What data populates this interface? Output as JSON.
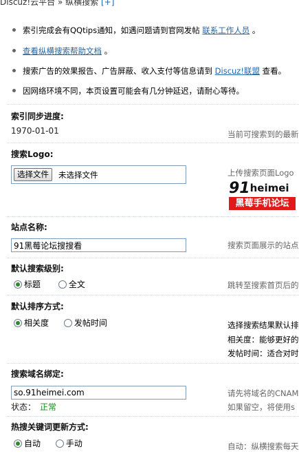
{
  "breadcrumb": {
    "text": "Discuz!云平台 » 纵横搜索",
    "plus": "[+]"
  },
  "tips": [
    {
      "text": "索引完成会有QQtips通知，如遇问题请到官网发帖 ",
      "link": "联系工作人员",
      "suffix": " 。"
    },
    {
      "text": "",
      "link": "查看纵横搜索帮助文档",
      "suffix": " 。"
    },
    {
      "text": "搜索广告的效果报告、广告屏蔽、收入支付等信息请到 ",
      "link": "Discuz!联盟",
      "suffix": " 查看。"
    },
    {
      "text": "因网络环境不同，本页设置可能会有几分钟延迟，请耐心等待。",
      "link": "",
      "suffix": ""
    }
  ],
  "sync": {
    "label": "索引同步进度:",
    "value": "1970-01-01",
    "hint": "当前可搜索到的最新"
  },
  "logo": {
    "label": "搜索Logo:",
    "button": "选择文件",
    "file_status": "未选择文件",
    "hint": "上传搜索页面Logo",
    "image_top_num": "91",
    "image_top_word": "heimei",
    "image_bottom": "黑莓手机论坛"
  },
  "site_name": {
    "label": "站点名称:",
    "value": "91黑莓论坛搜搜看",
    "hint": "搜索页面展示的站点"
  },
  "search_level": {
    "label": "默认搜索级别:",
    "options": [
      "标题",
      "全文"
    ],
    "selected": 0,
    "hint": "跳转至搜索首页后的"
  },
  "sort_order": {
    "label": "默认排序方式:",
    "options": [
      "相关度",
      "发帖时间"
    ],
    "selected": 0,
    "hints": [
      "选择搜索结果默认排",
      "相关度：能够更好的",
      "发帖时间：适合对时"
    ]
  },
  "domain": {
    "label": "搜索域名绑定:",
    "value": "so.91heimei.com",
    "status_label": "状态：",
    "status_value": "正常",
    "hints": [
      "请先将域名的CNAM",
      "如果留空，将使用s"
    ]
  },
  "hotword": {
    "label": "热搜关键词更新方式:",
    "options": [
      "自动",
      "手动"
    ],
    "selected": 0,
    "hint": "自动：纵横搜索每天"
  },
  "colors": {
    "link": "#2366a8",
    "status_ok": "#1c8a1c",
    "logo_red": "#e11919"
  }
}
